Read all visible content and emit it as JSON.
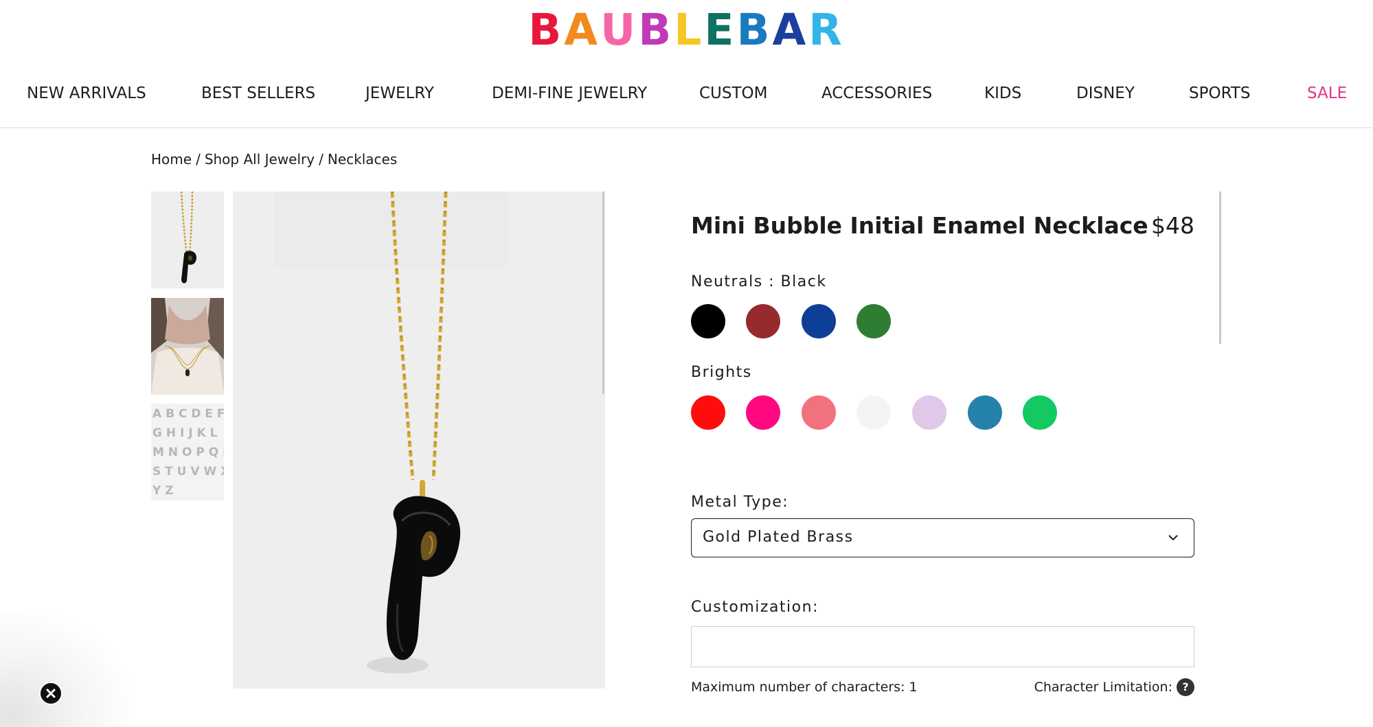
{
  "brand": {
    "letters": [
      {
        "char": "B",
        "color": "#e8173e"
      },
      {
        "char": "A",
        "color": "#f28a1f"
      },
      {
        "char": "U",
        "color": "#f466a8"
      },
      {
        "char": "B",
        "color": "#c03ab8"
      },
      {
        "char": "L",
        "color": "#f7c624"
      },
      {
        "char": "E",
        "color": "#0e7262"
      },
      {
        "char": "B",
        "color": "#1a7abf"
      },
      {
        "char": "A",
        "color": "#1b3f9e"
      },
      {
        "char": "R",
        "color": "#33b4e8"
      }
    ]
  },
  "nav": {
    "items": [
      {
        "label": "NEW ARRIVALS"
      },
      {
        "label": "BEST SELLERS"
      },
      {
        "label": "JEWELRY"
      },
      {
        "label": "DEMI-FINE JEWELRY"
      },
      {
        "label": "CUSTOM"
      },
      {
        "label": "ACCESSORIES"
      },
      {
        "label": "KIDS"
      },
      {
        "label": "DISNEY"
      },
      {
        "label": "SPORTS"
      },
      {
        "label": "SALE",
        "color": "#e0338c"
      }
    ]
  },
  "breadcrumb": {
    "items": [
      "Home",
      "Shop All Jewelry",
      "Necklaces"
    ],
    "separator": "/"
  },
  "gallery": {
    "thumbnails": [
      {
        "name": "necklace-black-p-thumbnail"
      },
      {
        "name": "model-wearing-necklace-thumbnail"
      },
      {
        "name": "alphabet-letters-thumbnail"
      }
    ],
    "main_image": "black-bubble-letter-p-necklace"
  },
  "product": {
    "title": "Mini Bubble Initial Enamel Necklace",
    "price": "$48"
  },
  "colors": {
    "neutrals_label": "Neutrals : Black",
    "neutrals": [
      "#000000",
      "#962a2d",
      "#0e3f96",
      "#2e7d32"
    ],
    "brights_label": "Brights",
    "brights": [
      "#ff0d0d",
      "#ff0880",
      "#f2717f",
      "#f4f4f4",
      "#e0c8e8",
      "#2582aa",
      "#12c962"
    ]
  },
  "metal": {
    "label": "Metal Type:",
    "selected": "Gold Plated Brass"
  },
  "customization": {
    "label": "Customization:",
    "value": "",
    "max_chars_text": "Maximum number of characters: 1",
    "limitation_text": "Character Limitation:",
    "help_glyph": "?"
  },
  "promo": {
    "close_icon": "close-icon"
  }
}
